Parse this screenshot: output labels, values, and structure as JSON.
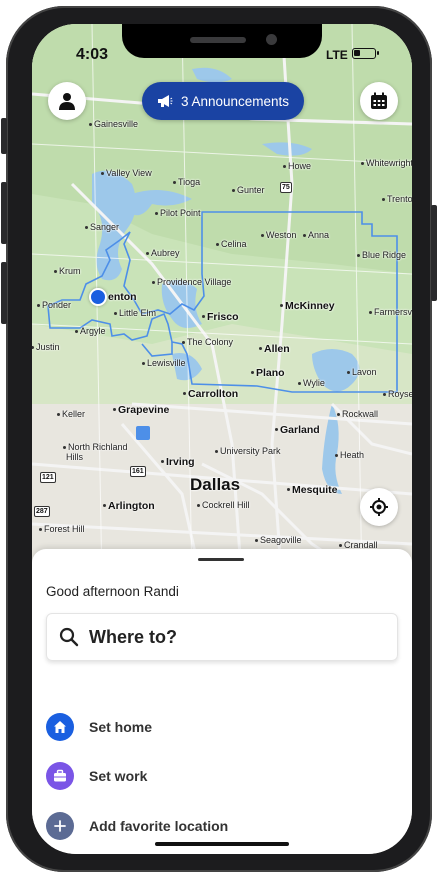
{
  "status": {
    "time": "4:03",
    "network": "LTE"
  },
  "announcement": {
    "label": "3 Announcements"
  },
  "map": {
    "cities": [
      {
        "name": "Gainesville",
        "cls": ""
      },
      {
        "name": "Valley View",
        "cls": ""
      },
      {
        "name": "Tioga",
        "cls": ""
      },
      {
        "name": "Gunter",
        "cls": ""
      },
      {
        "name": "Howe",
        "cls": ""
      },
      {
        "name": "Whitewright",
        "cls": ""
      },
      {
        "name": "Trenton",
        "cls": ""
      },
      {
        "name": "Sanger",
        "cls": ""
      },
      {
        "name": "Pilot Point",
        "cls": ""
      },
      {
        "name": "Celina",
        "cls": ""
      },
      {
        "name": "Weston",
        "cls": ""
      },
      {
        "name": "Anna",
        "cls": ""
      },
      {
        "name": "Blue Ridge",
        "cls": ""
      },
      {
        "name": "Aubrey",
        "cls": ""
      },
      {
        "name": "Krum",
        "cls": ""
      },
      {
        "name": "Providence Village",
        "cls": ""
      },
      {
        "name": "Ponder",
        "cls": ""
      },
      {
        "name": "enton",
        "cls": "big nodot"
      },
      {
        "name": "McKinney",
        "cls": "big"
      },
      {
        "name": "Farmersville",
        "cls": ""
      },
      {
        "name": "Argyle",
        "cls": ""
      },
      {
        "name": "Little Elm",
        "cls": ""
      },
      {
        "name": "Frisco",
        "cls": "big"
      },
      {
        "name": "Justin",
        "cls": ""
      },
      {
        "name": "The Colony",
        "cls": ""
      },
      {
        "name": "Allen",
        "cls": "big"
      },
      {
        "name": "Lewisville",
        "cls": ""
      },
      {
        "name": "Plano",
        "cls": "big"
      },
      {
        "name": "Lavon",
        "cls": ""
      },
      {
        "name": "Wylie",
        "cls": ""
      },
      {
        "name": "Carrollton",
        "cls": "big"
      },
      {
        "name": "Royse",
        "cls": ""
      },
      {
        "name": "Keller",
        "cls": ""
      },
      {
        "name": "Grapevine",
        "cls": "big"
      },
      {
        "name": "Rockwall",
        "cls": ""
      },
      {
        "name": "Garland",
        "cls": "big"
      },
      {
        "name": "North Richland",
        "cls": ""
      },
      {
        "name": "Hills",
        "cls": "nodot"
      },
      {
        "name": "University Park",
        "cls": ""
      },
      {
        "name": "Heath",
        "cls": ""
      },
      {
        "name": "Irving",
        "cls": "big"
      },
      {
        "name": "Dallas",
        "cls": "dallas"
      },
      {
        "name": "Mesquite",
        "cls": "big"
      },
      {
        "name": "Arlington",
        "cls": "big"
      },
      {
        "name": "Cockrell Hill",
        "cls": ""
      },
      {
        "name": "Forest Hill",
        "cls": ""
      },
      {
        "name": "Seagoville",
        "cls": ""
      },
      {
        "name": "Crandall",
        "cls": ""
      }
    ],
    "shields": [
      "75",
      "121",
      "161",
      "287"
    ]
  },
  "sheet": {
    "greeting": "Good afternoon Randi",
    "search_placeholder": "Where to?",
    "shortcuts": [
      {
        "label": "Set home",
        "icon": "home-icon",
        "color": "#1a5fe0"
      },
      {
        "label": "Set work",
        "icon": "briefcase-icon",
        "color": "#7a55e6"
      },
      {
        "label": "Add favorite location",
        "icon": "plus-icon",
        "color": "#5c6b94"
      }
    ]
  }
}
